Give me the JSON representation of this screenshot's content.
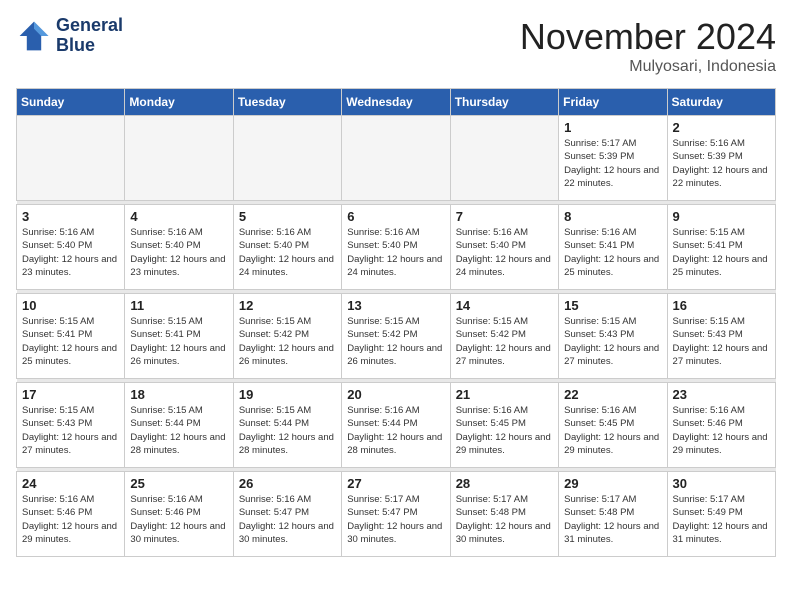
{
  "header": {
    "logo_line1": "General",
    "logo_line2": "Blue",
    "month": "November 2024",
    "location": "Mulyosari, Indonesia"
  },
  "weekdays": [
    "Sunday",
    "Monday",
    "Tuesday",
    "Wednesday",
    "Thursday",
    "Friday",
    "Saturday"
  ],
  "weeks": [
    [
      {
        "day": "",
        "empty": true
      },
      {
        "day": "",
        "empty": true
      },
      {
        "day": "",
        "empty": true
      },
      {
        "day": "",
        "empty": true
      },
      {
        "day": "",
        "empty": true
      },
      {
        "day": "1",
        "sunrise": "5:17 AM",
        "sunset": "5:39 PM",
        "daylight": "12 hours and 22 minutes."
      },
      {
        "day": "2",
        "sunrise": "5:16 AM",
        "sunset": "5:39 PM",
        "daylight": "12 hours and 22 minutes."
      }
    ],
    [
      {
        "day": "3",
        "sunrise": "5:16 AM",
        "sunset": "5:40 PM",
        "daylight": "12 hours and 23 minutes."
      },
      {
        "day": "4",
        "sunrise": "5:16 AM",
        "sunset": "5:40 PM",
        "daylight": "12 hours and 23 minutes."
      },
      {
        "day": "5",
        "sunrise": "5:16 AM",
        "sunset": "5:40 PM",
        "daylight": "12 hours and 24 minutes."
      },
      {
        "day": "6",
        "sunrise": "5:16 AM",
        "sunset": "5:40 PM",
        "daylight": "12 hours and 24 minutes."
      },
      {
        "day": "7",
        "sunrise": "5:16 AM",
        "sunset": "5:40 PM",
        "daylight": "12 hours and 24 minutes."
      },
      {
        "day": "8",
        "sunrise": "5:16 AM",
        "sunset": "5:41 PM",
        "daylight": "12 hours and 25 minutes."
      },
      {
        "day": "9",
        "sunrise": "5:15 AM",
        "sunset": "5:41 PM",
        "daylight": "12 hours and 25 minutes."
      }
    ],
    [
      {
        "day": "10",
        "sunrise": "5:15 AM",
        "sunset": "5:41 PM",
        "daylight": "12 hours and 25 minutes."
      },
      {
        "day": "11",
        "sunrise": "5:15 AM",
        "sunset": "5:41 PM",
        "daylight": "12 hours and 26 minutes."
      },
      {
        "day": "12",
        "sunrise": "5:15 AM",
        "sunset": "5:42 PM",
        "daylight": "12 hours and 26 minutes."
      },
      {
        "day": "13",
        "sunrise": "5:15 AM",
        "sunset": "5:42 PM",
        "daylight": "12 hours and 26 minutes."
      },
      {
        "day": "14",
        "sunrise": "5:15 AM",
        "sunset": "5:42 PM",
        "daylight": "12 hours and 27 minutes."
      },
      {
        "day": "15",
        "sunrise": "5:15 AM",
        "sunset": "5:43 PM",
        "daylight": "12 hours and 27 minutes."
      },
      {
        "day": "16",
        "sunrise": "5:15 AM",
        "sunset": "5:43 PM",
        "daylight": "12 hours and 27 minutes."
      }
    ],
    [
      {
        "day": "17",
        "sunrise": "5:15 AM",
        "sunset": "5:43 PM",
        "daylight": "12 hours and 27 minutes."
      },
      {
        "day": "18",
        "sunrise": "5:15 AM",
        "sunset": "5:44 PM",
        "daylight": "12 hours and 28 minutes."
      },
      {
        "day": "19",
        "sunrise": "5:15 AM",
        "sunset": "5:44 PM",
        "daylight": "12 hours and 28 minutes."
      },
      {
        "day": "20",
        "sunrise": "5:16 AM",
        "sunset": "5:44 PM",
        "daylight": "12 hours and 28 minutes."
      },
      {
        "day": "21",
        "sunrise": "5:16 AM",
        "sunset": "5:45 PM",
        "daylight": "12 hours and 29 minutes."
      },
      {
        "day": "22",
        "sunrise": "5:16 AM",
        "sunset": "5:45 PM",
        "daylight": "12 hours and 29 minutes."
      },
      {
        "day": "23",
        "sunrise": "5:16 AM",
        "sunset": "5:46 PM",
        "daylight": "12 hours and 29 minutes."
      }
    ],
    [
      {
        "day": "24",
        "sunrise": "5:16 AM",
        "sunset": "5:46 PM",
        "daylight": "12 hours and 29 minutes."
      },
      {
        "day": "25",
        "sunrise": "5:16 AM",
        "sunset": "5:46 PM",
        "daylight": "12 hours and 30 minutes."
      },
      {
        "day": "26",
        "sunrise": "5:16 AM",
        "sunset": "5:47 PM",
        "daylight": "12 hours and 30 minutes."
      },
      {
        "day": "27",
        "sunrise": "5:17 AM",
        "sunset": "5:47 PM",
        "daylight": "12 hours and 30 minutes."
      },
      {
        "day": "28",
        "sunrise": "5:17 AM",
        "sunset": "5:48 PM",
        "daylight": "12 hours and 30 minutes."
      },
      {
        "day": "29",
        "sunrise": "5:17 AM",
        "sunset": "5:48 PM",
        "daylight": "12 hours and 31 minutes."
      },
      {
        "day": "30",
        "sunrise": "5:17 AM",
        "sunset": "5:49 PM",
        "daylight": "12 hours and 31 minutes."
      }
    ]
  ]
}
